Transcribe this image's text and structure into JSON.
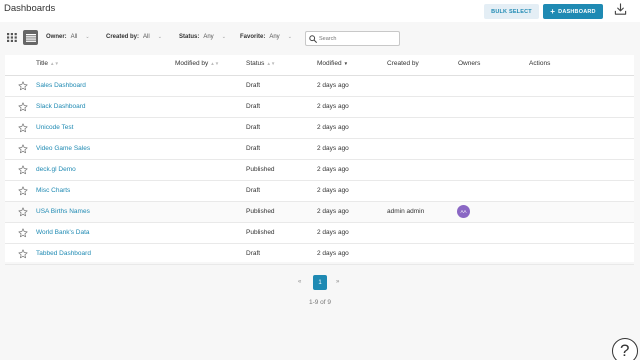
{
  "header": {
    "title": "Dashboards",
    "bulk_select_label": "BULK SELECT",
    "add_dashboard_label": "DASHBOARD",
    "add_icon": "+",
    "import_icon": "import-icon"
  },
  "filters": {
    "owner": {
      "label": "Owner:",
      "value": "All"
    },
    "created_by": {
      "label": "Created by:",
      "value": "All"
    },
    "status": {
      "label": "Status:",
      "value": "Any"
    },
    "favorite": {
      "label": "Favorite:",
      "value": "Any"
    },
    "search": {
      "placeholder": "Search",
      "value": ""
    },
    "view_modes": [
      "card-view-icon",
      "list-view-icon"
    ],
    "active_view": "list"
  },
  "table": {
    "columns": [
      {
        "label": "Title",
        "sortable": true,
        "sort_state": "none"
      },
      {
        "label": "Modified by",
        "sortable": true,
        "sort_state": "none"
      },
      {
        "label": "Status",
        "sortable": true,
        "sort_state": "none"
      },
      {
        "label": "Modified",
        "sortable": true,
        "sort_state": "descending"
      },
      {
        "label": "Created by",
        "sortable": false
      },
      {
        "label": "Owners",
        "sortable": false
      },
      {
        "label": "Actions",
        "sortable": false
      }
    ],
    "rows": [
      {
        "title": "Sales Dashboard",
        "modified_by": "",
        "status": "Draft",
        "modified": "2 days ago",
        "created_by": "",
        "owner": ""
      },
      {
        "title": "Slack Dashboard",
        "modified_by": "",
        "status": "Draft",
        "modified": "2 days ago",
        "created_by": "",
        "owner": ""
      },
      {
        "title": "Unicode Test",
        "modified_by": "",
        "status": "Draft",
        "modified": "2 days ago",
        "created_by": "",
        "owner": ""
      },
      {
        "title": "Video Game Sales",
        "modified_by": "",
        "status": "Draft",
        "modified": "2 days ago",
        "created_by": "",
        "owner": ""
      },
      {
        "title": "deck.gl Demo",
        "modified_by": "",
        "status": "Published",
        "modified": "2 days ago",
        "created_by": "",
        "owner": ""
      },
      {
        "title": "Misc Charts",
        "modified_by": "",
        "status": "Draft",
        "modified": "2 days ago",
        "created_by": "",
        "owner": ""
      },
      {
        "title": "USA Births Names",
        "modified_by": "",
        "status": "Published",
        "modified": "2 days ago",
        "created_by": "admin admin",
        "owner": "AA"
      },
      {
        "title": "World Bank's Data",
        "modified_by": "",
        "status": "Published",
        "modified": "2 days ago",
        "created_by": "",
        "owner": ""
      },
      {
        "title": "Tabbed Dashboard",
        "modified_by": "",
        "status": "Draft",
        "modified": "2 days ago",
        "created_by": "",
        "owner": ""
      }
    ]
  },
  "pagination": {
    "prev": "«",
    "current_page": "1",
    "next": "»",
    "summary": "1-9 of 9"
  },
  "help": {
    "label": "?"
  },
  "colors": {
    "accent": "#1f8ab3",
    "avatar": "#8a67c4",
    "background": "#f7f7f7"
  }
}
